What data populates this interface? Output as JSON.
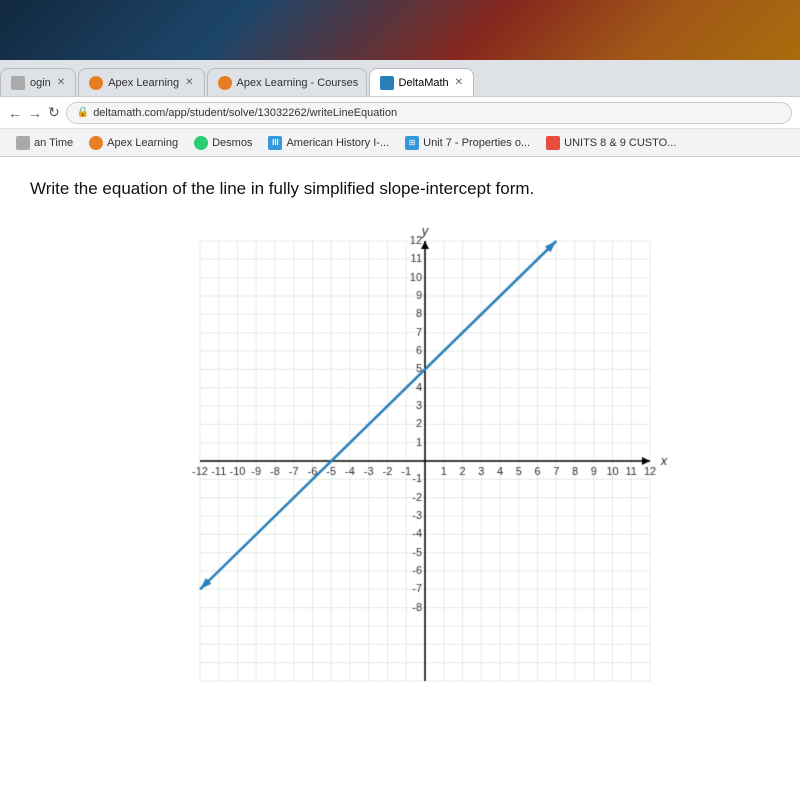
{
  "browser": {
    "tabs": [
      {
        "id": "tab-login",
        "label": "ogin",
        "active": false,
        "icon_color": "#666"
      },
      {
        "id": "tab-apex1",
        "label": "Apex Learning",
        "active": false,
        "icon_color": "#e67e22"
      },
      {
        "id": "tab-apex2",
        "label": "Apex Learning - Courses",
        "active": false,
        "icon_color": "#e67e22"
      },
      {
        "id": "tab-deltamath",
        "label": "DeltaMath",
        "active": true,
        "icon_color": "#2980b9"
      }
    ],
    "address": "deltamath.com/app/student/solve/13032262/writeLineEquation",
    "bookmarks": [
      {
        "label": "an Time",
        "icon_color": "#555"
      },
      {
        "label": "Apex Learning",
        "icon_color": "#e67e22"
      },
      {
        "label": "Desmos",
        "icon_color": "#2ecc71"
      },
      {
        "label": "American History I-...",
        "icon_color": "#3498db"
      },
      {
        "label": "Unit 7 - Properties o...",
        "icon_color": "#3498db"
      },
      {
        "label": "UNITS 8 & 9 CUSTO...",
        "icon_color": "#e74c3c"
      }
    ]
  },
  "page": {
    "question": "Write the equation of the line in fully simplified slope-intercept form.",
    "graph": {
      "x_min": -12,
      "x_max": 12,
      "y_min": -12,
      "y_max": 12,
      "line_slope": 1,
      "line_intercept": 5,
      "line_color": "#2980b9"
    }
  }
}
